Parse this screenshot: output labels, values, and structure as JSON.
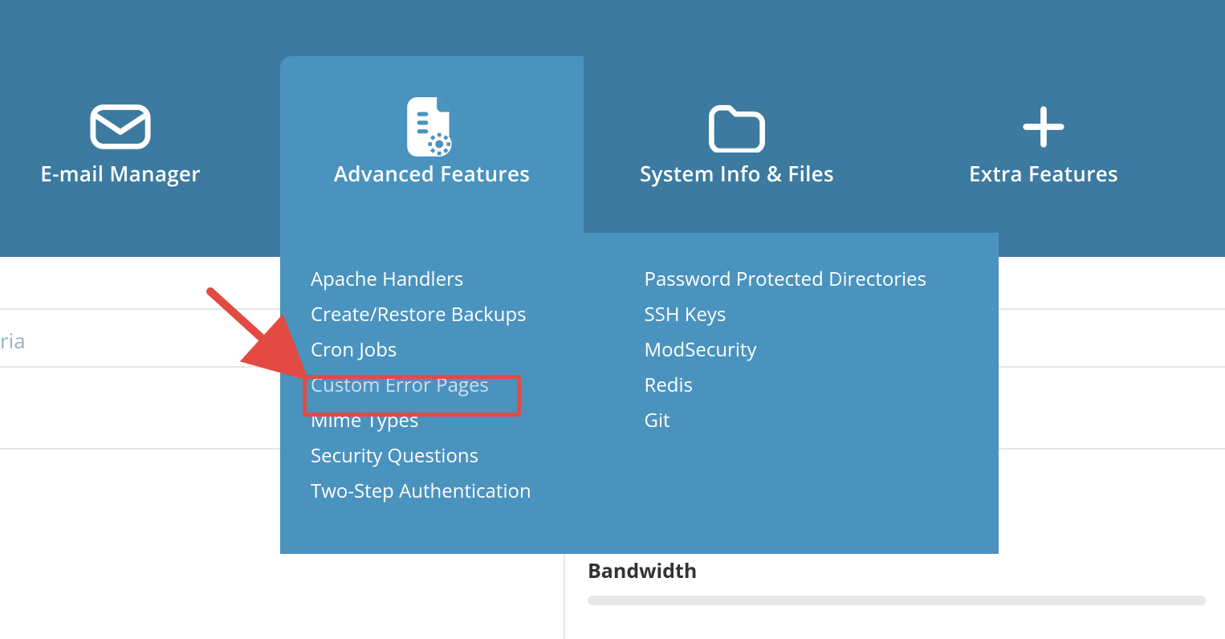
{
  "nav": {
    "email": {
      "label": "E-mail Manager"
    },
    "advanced": {
      "label": "Advanced Features"
    },
    "system": {
      "label": "System Info & Files"
    },
    "extra": {
      "label": "Extra Features"
    }
  },
  "dropdown": {
    "left": [
      "Apache Handlers",
      "Create/Restore Backups",
      "Cron Jobs",
      "Custom Error Pages",
      "Mime Types",
      "Security Questions",
      "Two-Step Authentication"
    ],
    "right": [
      "Password Protected Directories",
      "SSH Keys",
      "ModSecurity",
      "Redis",
      "Git"
    ]
  },
  "background": {
    "search_fragment": "ria",
    "section_heading": "Bandwidth"
  },
  "annotation": {
    "highlighted_item": "Custom Error Pages",
    "color": "#e34a42"
  }
}
